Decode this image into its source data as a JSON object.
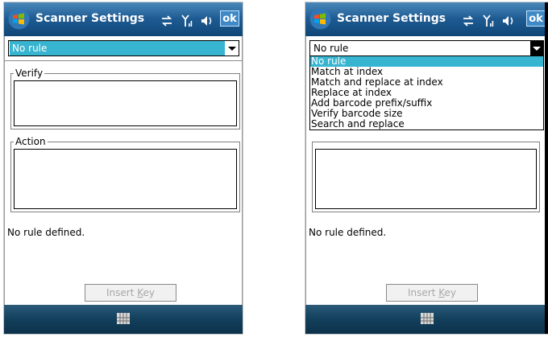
{
  "left_screen": {
    "title": "Scanner Settings",
    "ok_label": "ok",
    "combo": {
      "value": "No rule"
    },
    "verify_label": "Verify",
    "action_label": "Action",
    "status": "No rule defined.",
    "insert_key": {
      "text": "Insert ",
      "underlined": "K",
      "rest": "ey"
    }
  },
  "right_screen": {
    "title": "Scanner Settings",
    "ok_label": "ok",
    "combo": {
      "value": "No rule"
    },
    "dropdown_options": [
      "No rule",
      "Match at index",
      "Match and replace at index",
      "Replace at index",
      "Add barcode prefix/suffix",
      "Verify barcode size",
      "Search and replace"
    ],
    "selected_index": 0,
    "status": "No rule defined.",
    "insert_key": {
      "text": "Insert ",
      "underlined": "K",
      "rest": "ey"
    }
  },
  "icons": [
    "windows-start-icon",
    "sync-icon",
    "signal-icon",
    "volume-icon",
    "soft-keyboard-icon",
    "dropdown-arrow-icon"
  ],
  "colors": {
    "title_bar": "#1e5b93",
    "selection": "#37b4cf",
    "bottom_bar": "#123f5c",
    "disabled_text": "#a7a7a7"
  }
}
